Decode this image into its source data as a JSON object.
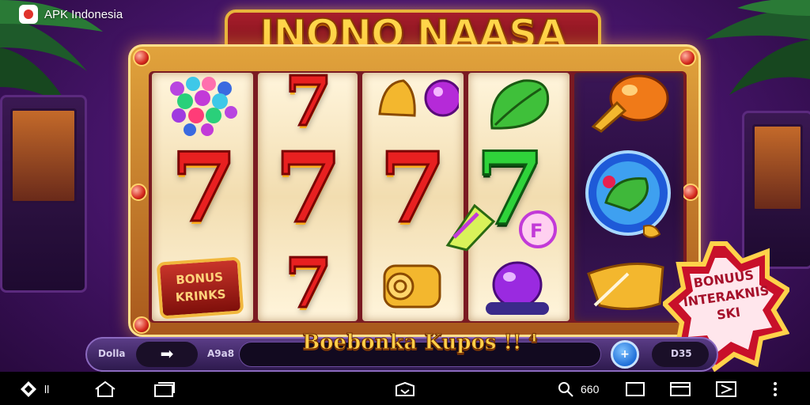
{
  "watermark": {
    "text": "APK Indonesia"
  },
  "game": {
    "title": "INONO NAASA",
    "reels": [
      [
        "grape-cluster",
        "seven-red",
        "bonus-plaque"
      ],
      [
        "seven-red",
        "seven-red",
        "seven-red"
      ],
      [
        "golden-bell",
        "seven-red",
        "golden-scroll"
      ],
      [
        "green-leaf",
        "seven-green",
        "purple-plum"
      ],
      [
        "orange-mushroom",
        "crystal-orb",
        "golden-horn"
      ]
    ],
    "seven_glyph": "7",
    "bonus_plaque": {
      "line1": "BONUS",
      "line2": "KRINKS"
    },
    "bonus_badge": {
      "line1": "BONUUS",
      "line2": "INTERAKNIS",
      "line3": "SKI"
    },
    "message": "Boebonka Kupos !! ⁴",
    "controls": {
      "left_label": "Dolla",
      "arrow_glyph": "➡",
      "bet_label": "A9a8",
      "round_button_glyph": "+",
      "right_label": "D35"
    }
  },
  "colors": {
    "accent_gold": "#e8b53c",
    "frame_red": "#7a1a22",
    "bg_purple": "#4a1670"
  },
  "navbar": {
    "logo_text": "ll",
    "counter_text": "660",
    "icons": [
      "app-logo-icon",
      "home-icon",
      "recent-apps-icon",
      "keyboard-icon",
      "search-icon",
      "window-icon",
      "screenshot-icon",
      "cast-icon",
      "more-icon"
    ]
  }
}
